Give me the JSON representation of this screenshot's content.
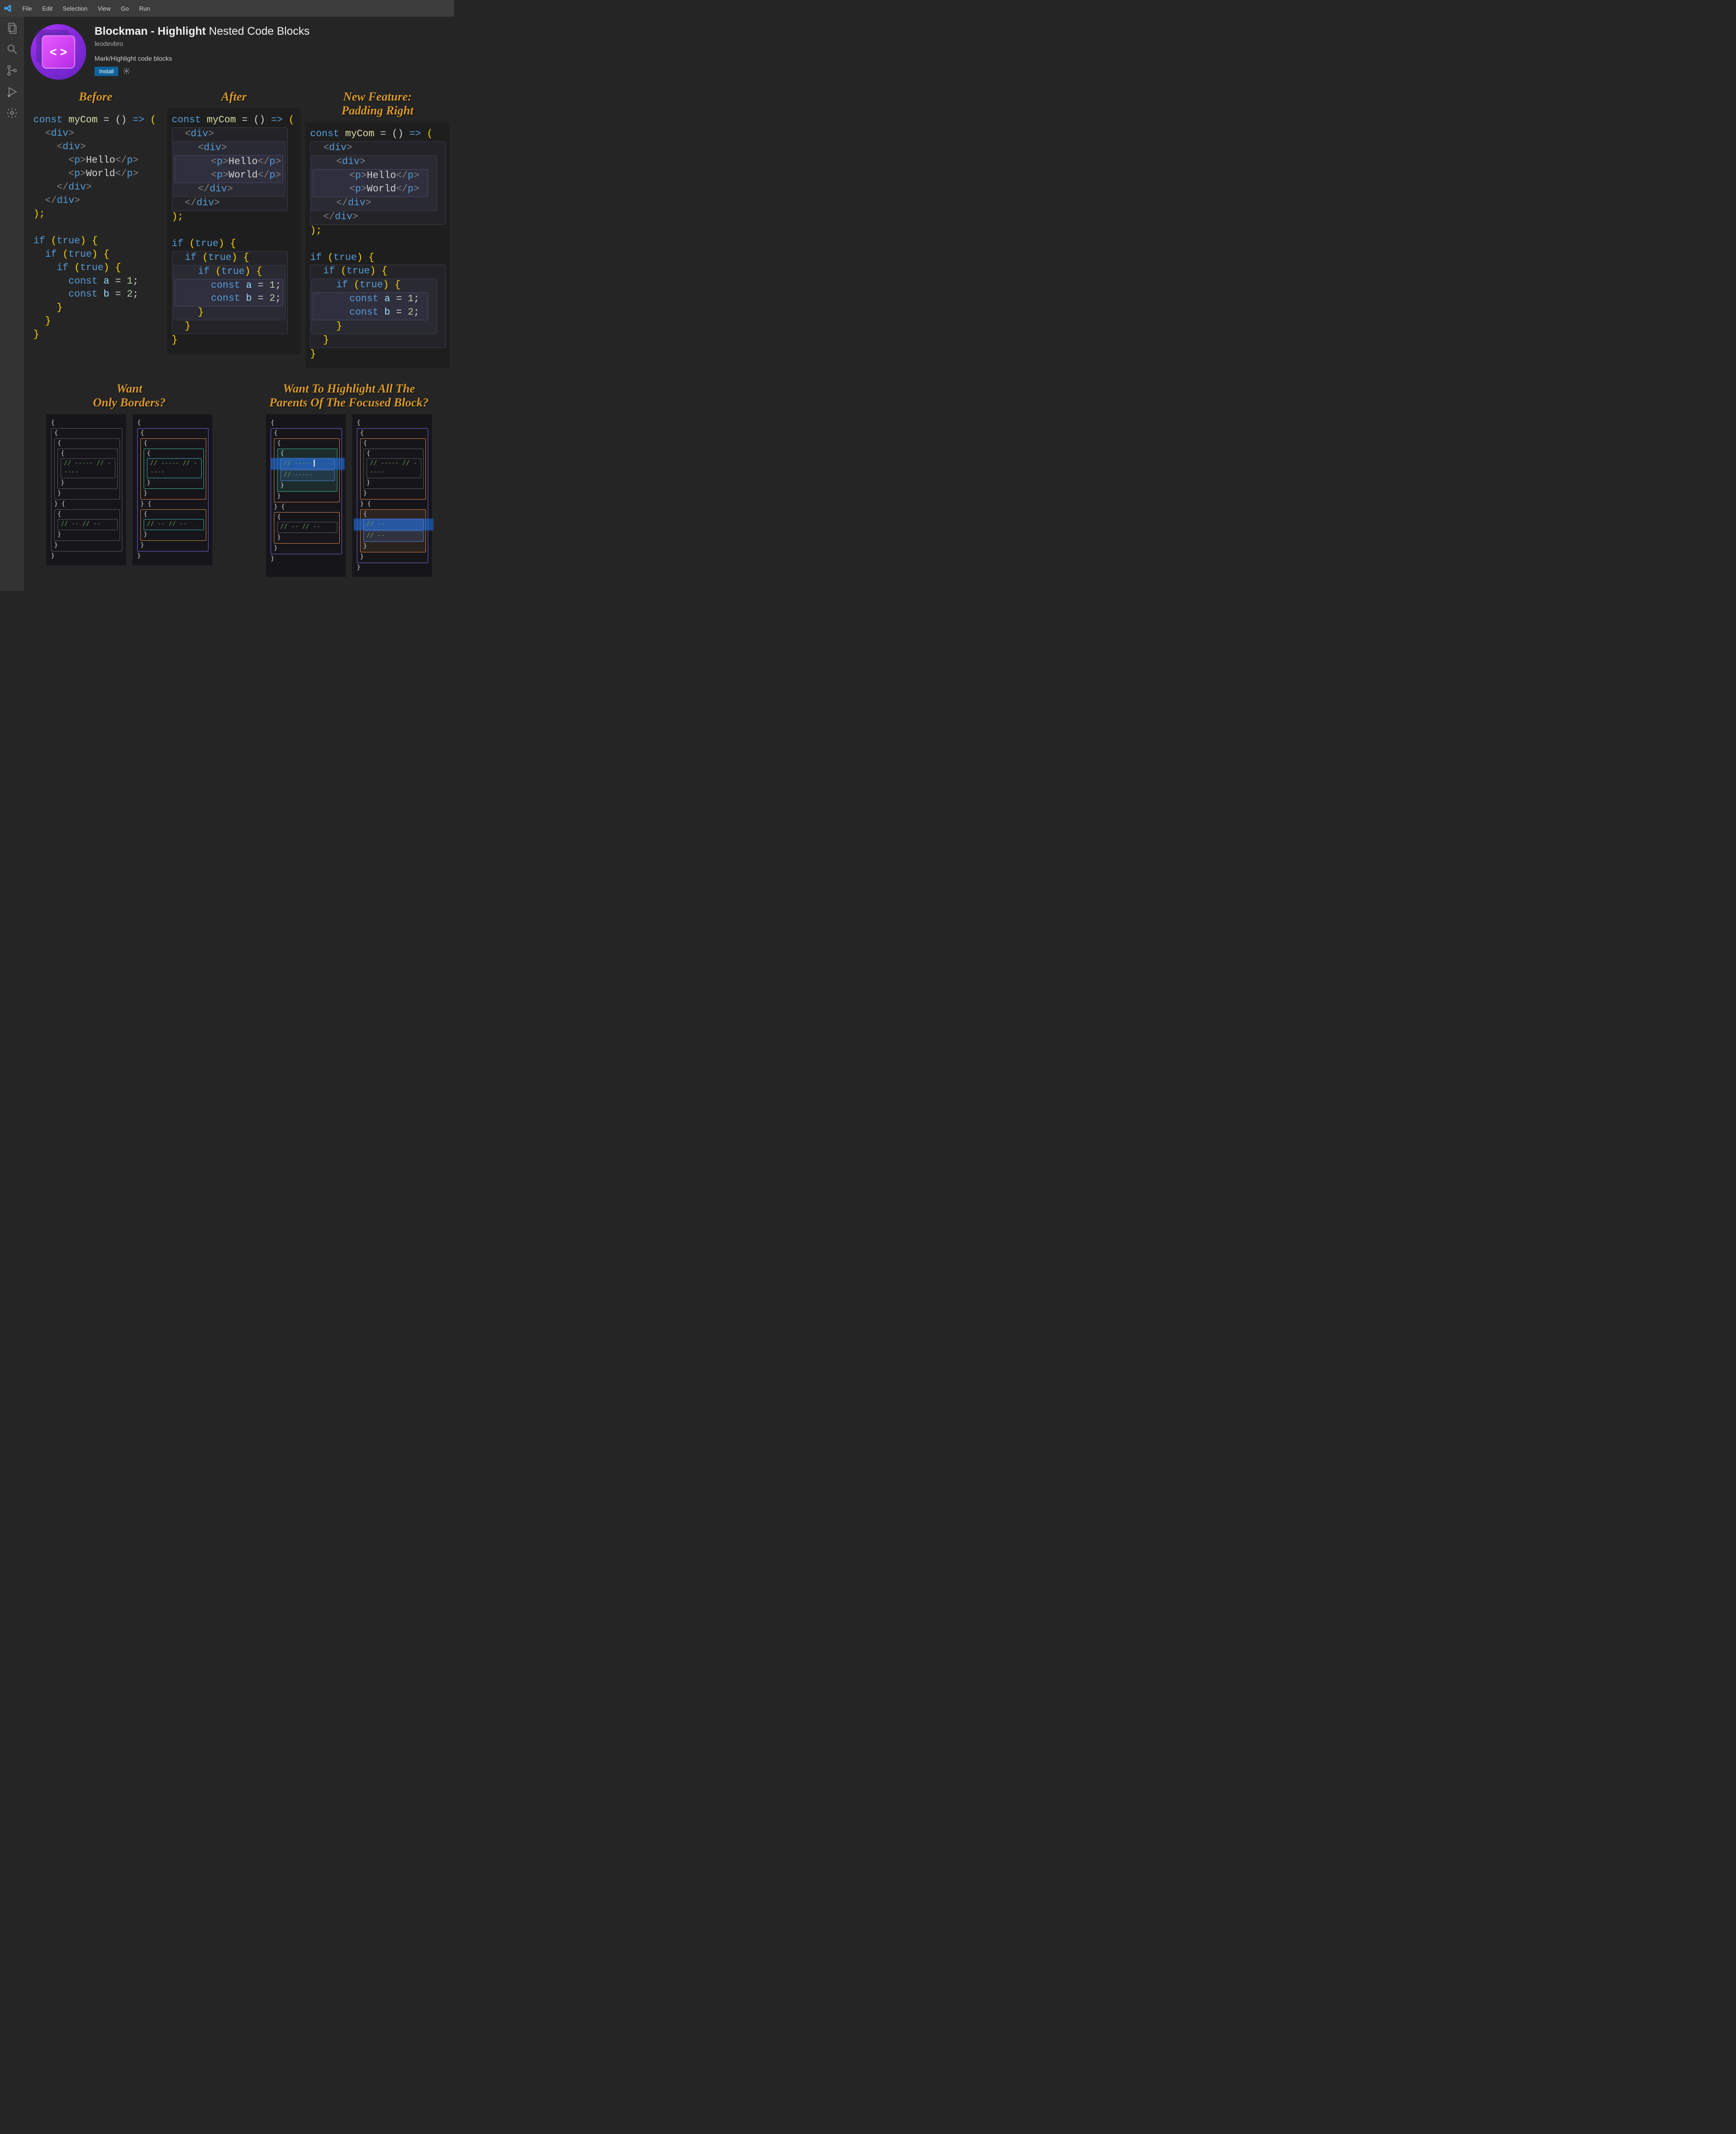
{
  "menu": {
    "file": "File",
    "edit": "Edit",
    "selection": "Selection",
    "view": "View",
    "go": "Go",
    "run": "Run"
  },
  "ext": {
    "title_main": "Blockman - Highlight",
    "title_sub": "Nested Code Blocks",
    "publisher": "leodevbro",
    "description": "Mark/Highlight code blocks",
    "install": "Install"
  },
  "headings": {
    "before": "Before",
    "after": "After",
    "newfeat_l1": "New Feature:",
    "newfeat_l2": "Padding Right",
    "want_l1": "Want",
    "want_l2": "Only Borders?",
    "parents_l1": "Want To Highlight All The",
    "parents_l2": "Parents Of The Focused Block?"
  },
  "code": {
    "l1_a": "const ",
    "l1_b": "myCom ",
    "l1_c": "= () ",
    "l1_d": "=>",
    "l1_e": " (",
    "divO": "<div>",
    "divC": "</div>",
    "pHelloO": "<p>",
    "hello": "Hello",
    "pC": "</p>",
    "world": "World",
    "close": ");",
    "ifO": "if ",
    "true": "true",
    "bro": ") {",
    "constA_a": "const ",
    "constA_b": "a ",
    "constA_c": "= ",
    "constA_d": "1",
    "semi": ";",
    "constB_b": "b ",
    "constB_d": "2",
    "brc": "}"
  },
  "mini": {
    "cmnt5": "// -----",
    "cmnt2": "// --",
    "ob": "{",
    "cb": "}"
  }
}
